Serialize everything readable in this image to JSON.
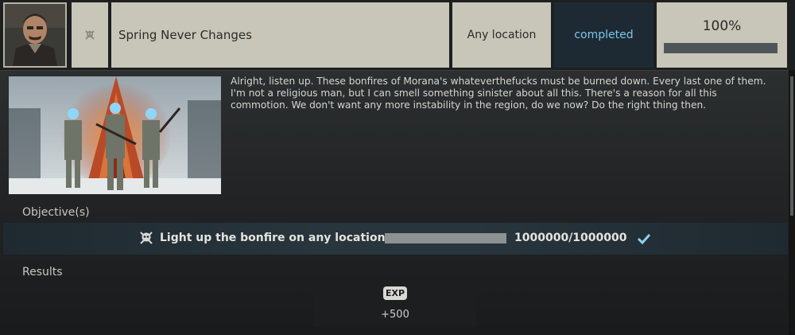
{
  "header": {
    "quest_name": "Spring Never Changes",
    "location": "Any location",
    "status": "completed",
    "progress_text": "100%",
    "progress_value": 1.0,
    "trader_avatar": "trader-portrait",
    "type_icon": "skull-icon"
  },
  "description": "Alright, listen up. These bonfires of Morana's whateverthefucks must be burned down. Every last one of them. I'm not a religious man, but I can smell something sinister about all this. There's a reason for all this commotion. We don't want any more instability in the region, do we now? Do the right thing then.",
  "objectives": {
    "label": "Objective(s)",
    "items": [
      {
        "icon": "skull-icon",
        "text": "Light up the bonfire on any location",
        "count": "1000000/1000000",
        "progress_value": 1.0,
        "done": true
      }
    ]
  },
  "results": {
    "label": "Results",
    "rewards": [
      {
        "badge": "EXP",
        "amount": "+500"
      }
    ]
  },
  "colors": {
    "status_text": "#7ec5e8",
    "check": "#8fd3f0",
    "header_cell": "#c8c6b8"
  }
}
